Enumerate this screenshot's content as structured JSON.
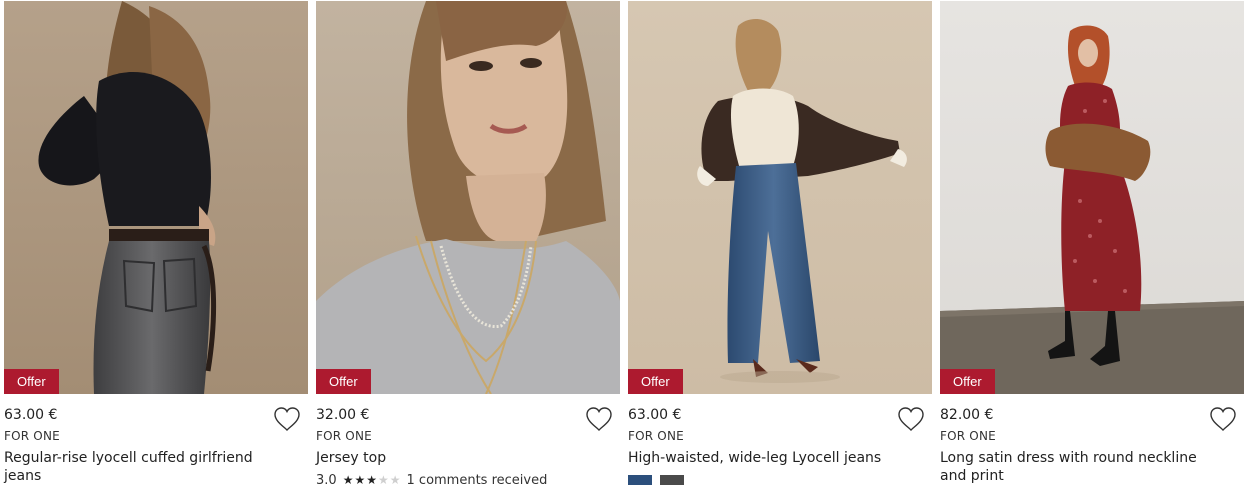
{
  "products": [
    {
      "badge": "Offer",
      "price": "63.00 €",
      "unit": "FOR ONE",
      "name": "Regular-rise lyocell cuffed girlfriend jeans",
      "image_alt": "Woman in black sweater and grey jeans"
    },
    {
      "badge": "Offer",
      "price": "32.00 €",
      "unit": "FOR ONE",
      "name": "Jersey top",
      "rating": {
        "score": "3.0",
        "stars": 3,
        "max": 5,
        "comments": "1 comments received"
      },
      "image_alt": "Woman in grey jersey top with layered necklaces"
    },
    {
      "badge": "Offer",
      "price": "63.00 €",
      "unit": "FOR ONE",
      "name": "High-waisted, wide-leg Lyocell jeans",
      "swatches": [
        "#2c4f7c",
        "#4a4a4a"
      ],
      "image_alt": "Woman in wide-leg jeans and shearling jacket"
    },
    {
      "badge": "Offer",
      "price": "82.00 €",
      "unit": "FOR ONE",
      "name": "Long satin dress with round neckline and print",
      "image_alt": "Woman in long red printed satin dress"
    }
  ],
  "colors": {
    "badge": "#ad1a2f",
    "text": "#222222"
  },
  "icons": {
    "wishlist": "heart-outline-icon",
    "star": "star-icon"
  }
}
